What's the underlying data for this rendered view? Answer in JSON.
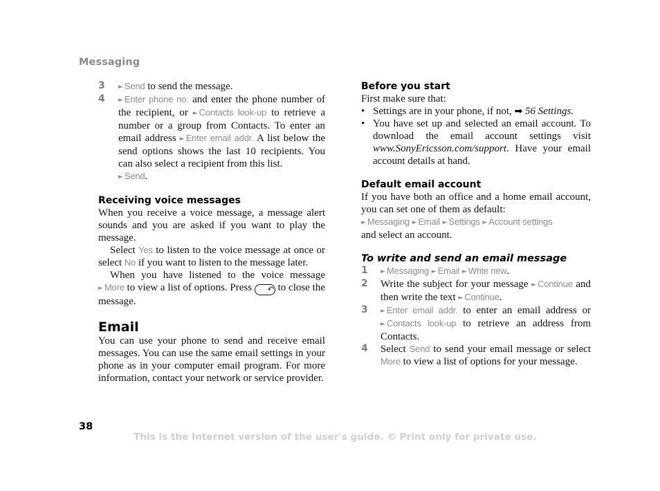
{
  "header": {
    "section": "Messaging"
  },
  "left": {
    "steps": [
      {
        "num": "3",
        "parts": {
          "m1": "Send",
          "t1": " to send the message."
        }
      },
      {
        "num": "4",
        "parts": {
          "m1": "Enter phone no.",
          "t1": " and enter the phone number of the recipient, or ",
          "m2": "Contacts look-up",
          "t2": " to retrieve a number or a group from Contacts. To enter an email address ",
          "m3": "Enter email addr.",
          "t3": " A list below the send options shows the last 10 recipients. You can also select a recipient from this list. ",
          "m4": "Send",
          "t4": "."
        }
      }
    ],
    "voice": {
      "heading": "Receiving voice messages",
      "p1": "When you receive a voice message, a message alert sounds and you are asked if you want to play the message.",
      "p2": {
        "t1": "Select ",
        "m1": "Yes",
        "t2": " to listen to the voice message at once or select ",
        "m2": "No",
        "t3": " if you want to listen to the message later."
      },
      "p3": {
        "t1": "When you have listened to the voice message ",
        "m1": "More",
        "t2": " to view a list of options. Press ",
        "key": "back-key",
        "key_glyph": "↶",
        "t3": " to close the message."
      }
    },
    "email": {
      "heading": "Email",
      "body": "You can use your phone to send and receive email messages. You can use the same email settings in your phone as in your computer email program. For more information, contact your network or service provider."
    }
  },
  "right": {
    "before": {
      "heading": "Before you start",
      "intro": "First make sure that:",
      "bullets": [
        {
          "t1": "Settings are in your phone, if not, ",
          "ref_icon": "➡",
          "ref": "56 Settings",
          "t2": "."
        },
        {
          "t1": "You have set up and selected an email account. To download the email account settings visit ",
          "url": "www.SonyEricsson.com/support",
          "t2": ". Have your email account details at hand."
        }
      ]
    },
    "default": {
      "heading": "Default email account",
      "body": "If you have both an office and a home email account, you can set one of them as default:",
      "path": [
        "Messaging",
        "Email",
        "Settings",
        "Account settings"
      ],
      "after": "and select an account."
    },
    "write": {
      "heading": "To write and send an email message",
      "steps": [
        {
          "num": "1",
          "path": [
            "Messaging",
            "Email",
            "Write new"
          ],
          "t_end": "."
        },
        {
          "num": "2",
          "t1": "Write the subject for your message ",
          "m1": "Continue",
          "t2": " and then write the text ",
          "m2": "Continue",
          "t3": "."
        },
        {
          "num": "3",
          "m1": "Enter email addr.",
          "t1": " to enter an email address or ",
          "m2": "Contacts look-up",
          "t2": " to retrieve an address from Contacts."
        },
        {
          "num": "4",
          "t1": "Select ",
          "m1": "Send",
          "t2": " to send your email message or select ",
          "m2": "More",
          "t3": " to view a list of options for your message."
        }
      ]
    }
  },
  "footer": {
    "page_number": "38",
    "notice": "This is the Internet version of the user's guide. © Print only for private use."
  },
  "glyphs": {
    "arrow": "►"
  },
  "colors": {
    "menu_text": "#8c8c8c",
    "footer_text": "#cfcfcf",
    "section_tab": "#8a8a8a"
  }
}
